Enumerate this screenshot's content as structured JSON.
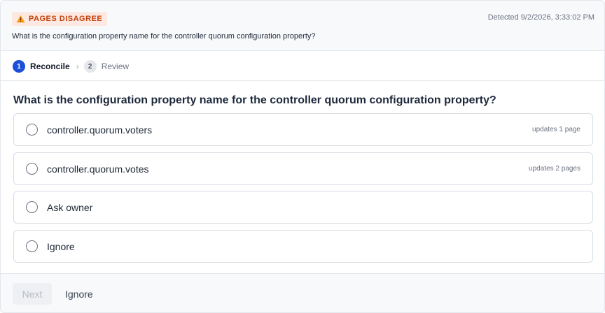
{
  "header": {
    "badge_label": "PAGES DISAGREE",
    "badge_icon": "warning-triangle-icon",
    "detected": "Detected 9/2/2026, 3:33:02 PM",
    "question": "What is the configuration property name for the controller quorum configuration property?"
  },
  "steps": [
    {
      "number": "1",
      "label": "Reconcile",
      "active": true
    },
    {
      "number": "2",
      "label": "Review",
      "active": false
    }
  ],
  "step_separator": "›",
  "question": "What is the configuration property name for the controller quorum configuration property?",
  "options": [
    {
      "label": "controller.quorum.voters",
      "meta": "updates 1 page"
    },
    {
      "label": "controller.quorum.votes",
      "meta": "updates 2 pages"
    },
    {
      "label": "Ask owner",
      "meta": ""
    },
    {
      "label": "Ignore",
      "meta": ""
    }
  ],
  "footer": {
    "next_label": "Next",
    "ignore_label": "Ignore"
  },
  "colors": {
    "accent": "#1d4ed8",
    "badge_bg": "#fde9e2",
    "badge_text": "#c2410c",
    "warning": "#f59e0b"
  }
}
